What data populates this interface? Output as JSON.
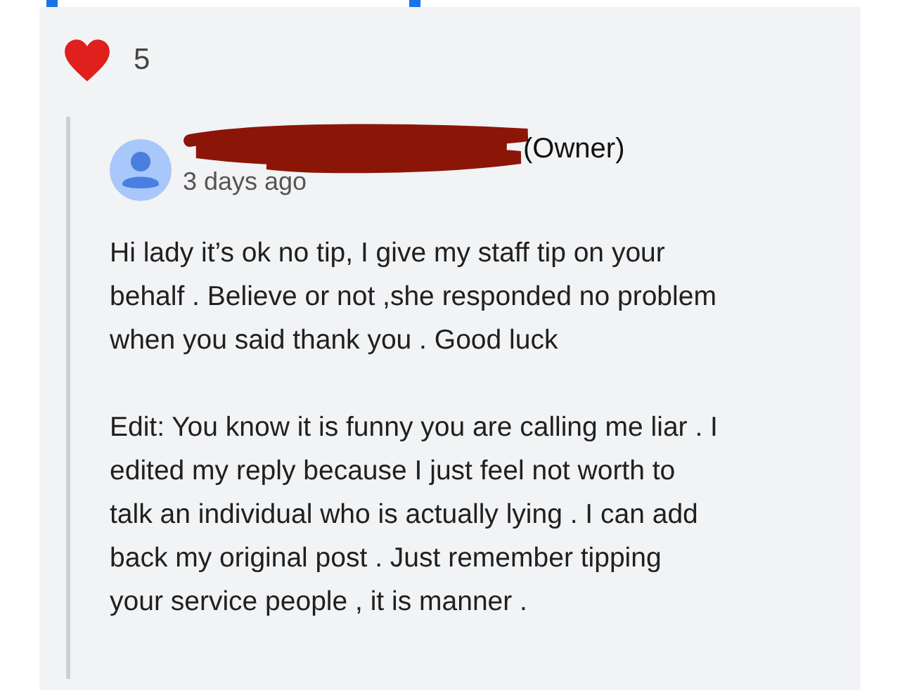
{
  "reactions": {
    "count": "5"
  },
  "reply": {
    "author_suffix": "(Owner)",
    "author_redacted": true,
    "time": "3 days ago",
    "paragraphs": [
      [
        "Hi lady it’s ok no tip, I give my staff tip on your",
        "behalf . Believe or not ,she responded no problem",
        "when you said thank you . Good luck"
      ],
      [
        "Edit: You know it is funny you are calling me liar . I",
        "edited my reply because I just feel not worth to",
        "talk an individual who is actually lying . I can add",
        "back my original post . Just remember tipping",
        "your service people , it is manner ."
      ]
    ]
  }
}
